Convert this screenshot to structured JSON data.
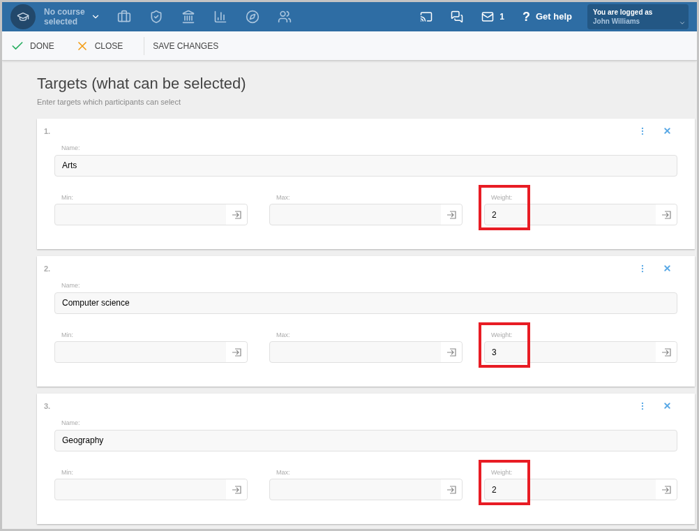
{
  "header": {
    "course": "No course\nselected",
    "messages_count": "1",
    "help_icon": "?",
    "help": "Get help",
    "user_label": "You are logged as",
    "user_name": "John Williams"
  },
  "toolbar": [
    {
      "kind": "done",
      "label": "DONE"
    },
    {
      "kind": "close",
      "label": "CLOSE"
    },
    {
      "kind": "save",
      "label": "SAVE CHANGES"
    }
  ],
  "title": "Targets (what can be selected)",
  "subtitle": "Enter targets which participants can select",
  "targets": [
    {
      "number": "1.",
      "name_label": "Name:",
      "name": "Arts",
      "fields": [
        {
          "label": "Min:",
          "highlighted": false
        },
        {
          "label": "Max:",
          "highlighted": false
        },
        {
          "label": "Weight:",
          "value": "2",
          "highlighted": true
        }
      ]
    },
    {
      "number": "2.",
      "name_label": "Name:",
      "name": "Computer science",
      "fields": [
        {
          "label": "Min:",
          "highlighted": false
        },
        {
          "label": "Max:",
          "highlighted": false
        },
        {
          "label": "Weight:",
          "value": "3",
          "highlighted": true
        }
      ]
    },
    {
      "number": "3.",
      "name_label": "Name:",
      "name": "Geography",
      "fields": [
        {
          "label": "Min:",
          "highlighted": false
        },
        {
          "label": "Max:",
          "highlighted": false
        },
        {
          "label": "Weight:",
          "value": "2",
          "highlighted": true
        }
      ]
    }
  ]
}
